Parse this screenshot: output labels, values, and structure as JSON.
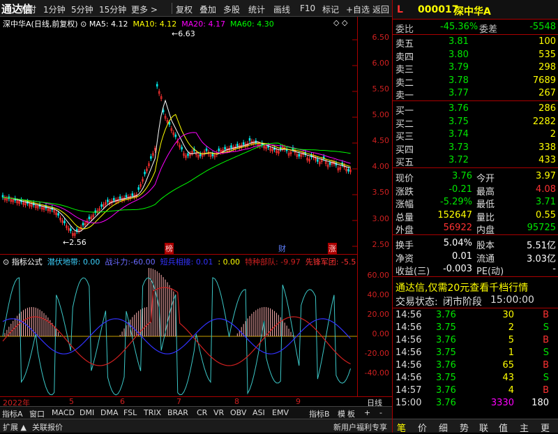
{
  "toolbar": {
    "logo": "通达信",
    "items": [
      "分时",
      "1分钟",
      "5分钟",
      "15分钟",
      "更多 >"
    ],
    "right_items": [
      "复权",
      "叠加",
      "多股",
      "统计",
      "画线",
      "F10",
      "标记",
      "+自选",
      "返回"
    ]
  },
  "chart_title": {
    "stock": "深中华A(日线,前复权)",
    "ma5": "MA5: 4.12",
    "ma10": "MA10: 4.12",
    "ma20": "MA20: 4.17",
    "ma60": "MA60: 4.30"
  },
  "price_annotations": {
    "high": "6.63",
    "low": "2.56"
  },
  "price_axis": [
    "6.50",
    "6.00",
    "5.50",
    "5.00",
    "4.50",
    "4.00",
    "3.50",
    "3.00",
    "2.50"
  ],
  "event_markers": [
    "榜",
    "财",
    "涨"
  ],
  "indicator_title": {
    "name": "指标公式",
    "a_label": "潜伏地带:",
    "a_value": "0.00",
    "b_label": "战斗力:",
    "b_value": "-60.00",
    "c_label": "短兵相接:",
    "c_value": "0.01",
    "d_label": ":",
    "d_value": "0.00",
    "e_label": "特种部队:",
    "e_value": "-9.97",
    "f_label": "先锋军团:",
    "f_value": "-5.5"
  },
  "indicator_axis": [
    "60.00",
    "40.00",
    "20.00",
    "0.00",
    "-20.00",
    "-40.00"
  ],
  "date_axis": [
    "2022年",
    "5",
    "6",
    "7",
    "8",
    "9",
    "日线"
  ],
  "indicator_tabs": [
    "指标A",
    "窗口",
    "MACD",
    "DMI",
    "DMA",
    "FSL",
    "TRIX",
    "BRAR",
    "CR",
    "VR",
    "OBV",
    "ASI",
    "EMV",
    "指标B",
    "模",
    "板",
    "+",
    "-"
  ],
  "bottom_bar": {
    "left1": "扩展",
    "left2": "关联报价",
    "promo": "新用户福利专享"
  },
  "quote": {
    "flag": "L",
    "code": "000017",
    "name": "深中华A",
    "weibi_label": "委比",
    "weibi": "-45.36%",
    "weicha_label": "委差",
    "weicha": "-5548",
    "asks": [
      {
        "label": "卖五",
        "price": "3.81",
        "vol": "100"
      },
      {
        "label": "卖四",
        "price": "3.80",
        "vol": "535"
      },
      {
        "label": "卖三",
        "price": "3.79",
        "vol": "298"
      },
      {
        "label": "卖二",
        "price": "3.78",
        "vol": "7689"
      },
      {
        "label": "卖一",
        "price": "3.77",
        "vol": "267"
      }
    ],
    "bids": [
      {
        "label": "买一",
        "price": "3.76",
        "vol": "286"
      },
      {
        "label": "买二",
        "price": "3.75",
        "vol": "2282"
      },
      {
        "label": "买三",
        "price": "3.74",
        "vol": "2"
      },
      {
        "label": "买四",
        "price": "3.73",
        "vol": "338"
      },
      {
        "label": "买五",
        "price": "3.72",
        "vol": "433"
      }
    ],
    "stats": [
      {
        "l1": "现价",
        "v1": "3.76",
        "l2": "今开",
        "v2": "3.97"
      },
      {
        "l1": "涨跌",
        "v1": "-0.21",
        "l2": "最高",
        "v2": "4.08"
      },
      {
        "l1": "涨幅",
        "v1": "-5.29%",
        "l2": "最低",
        "v2": "3.71"
      },
      {
        "l1": "总量",
        "v1": "152647",
        "l2": "量比",
        "v2": "0.55"
      },
      {
        "l1": "外盘",
        "v1": "56922",
        "l2": "内盘",
        "v2": "95725"
      }
    ],
    "fin": [
      {
        "l1": "换手",
        "v1": "5.04%",
        "l2": "股本",
        "v2": "5.51亿"
      },
      {
        "l1": "净资",
        "v1": "0.01",
        "l2": "流通",
        "v2": "3.03亿"
      },
      {
        "l1": "收益(三)",
        "v1": "-0.003",
        "l2": "PE(动)",
        "v2": "-"
      }
    ],
    "ad": "通达信,仅需20元查看千档行情",
    "status_label": "交易状态:",
    "status": "闭市阶段",
    "status_time": "15:00:00",
    "ticks": [
      {
        "time": "14:56",
        "price": "3.76",
        "vol": "30",
        "bs": "B"
      },
      {
        "time": "14:56",
        "price": "3.75",
        "vol": "2",
        "bs": "S"
      },
      {
        "time": "14:56",
        "price": "3.76",
        "vol": "5",
        "bs": "B"
      },
      {
        "time": "14:56",
        "price": "3.75",
        "vol": "1",
        "bs": "S"
      },
      {
        "time": "14:56",
        "price": "3.76",
        "vol": "65",
        "bs": "B"
      },
      {
        "time": "14:56",
        "price": "3.75",
        "vol": "43",
        "bs": "S"
      },
      {
        "time": "14:57",
        "price": "3.76",
        "vol": "4",
        "bs": "B"
      },
      {
        "time": "15:00",
        "price": "3.76",
        "vol": "3330",
        "bs": "180"
      }
    ],
    "bottom_tabs": [
      "笔",
      "价",
      "细",
      "势",
      "联",
      "值",
      "主",
      "更"
    ]
  },
  "colors": {
    "up": "#ff3232",
    "down": "#00e600",
    "ma5": "#ffffff",
    "ma10": "#ffff00",
    "ma20": "#ff00ff",
    "ma60": "#00ff00"
  }
}
